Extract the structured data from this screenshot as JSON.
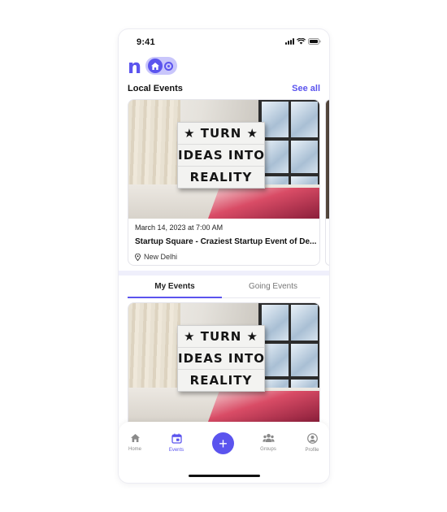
{
  "status_bar": {
    "time": "9:41"
  },
  "header": {
    "logo_text": "n",
    "home_icon": "home-icon"
  },
  "local_events": {
    "title": "Local Events",
    "see_all_label": "See all",
    "card": {
      "image_lines": [
        "★ TURN ★",
        "IDEAS INTO",
        "REALITY"
      ],
      "date": "March 14, 2023 at 7:00 AM",
      "title": "Startup Square - Craziest Startup Event of De...",
      "location": "New Delhi"
    }
  },
  "tabs": [
    {
      "label": "My Events",
      "active": true
    },
    {
      "label": "Going Events",
      "active": false
    }
  ],
  "my_events_card": {
    "image_lines": [
      "★ TURN ★",
      "IDEAS INTO",
      "REALITY"
    ]
  },
  "bottom_nav": {
    "items": [
      {
        "label": "Home",
        "icon": "home-icon"
      },
      {
        "label": "Events",
        "icon": "calendar-icon",
        "active": true
      },
      {
        "label": "Groups",
        "icon": "groups-icon"
      },
      {
        "label": "Profile",
        "icon": "profile-icon"
      }
    ],
    "fab_icon": "plus-icon",
    "fab_label": "+"
  },
  "colors": {
    "accent": "#5b54ee",
    "accent_light": "#c9c6fb"
  }
}
